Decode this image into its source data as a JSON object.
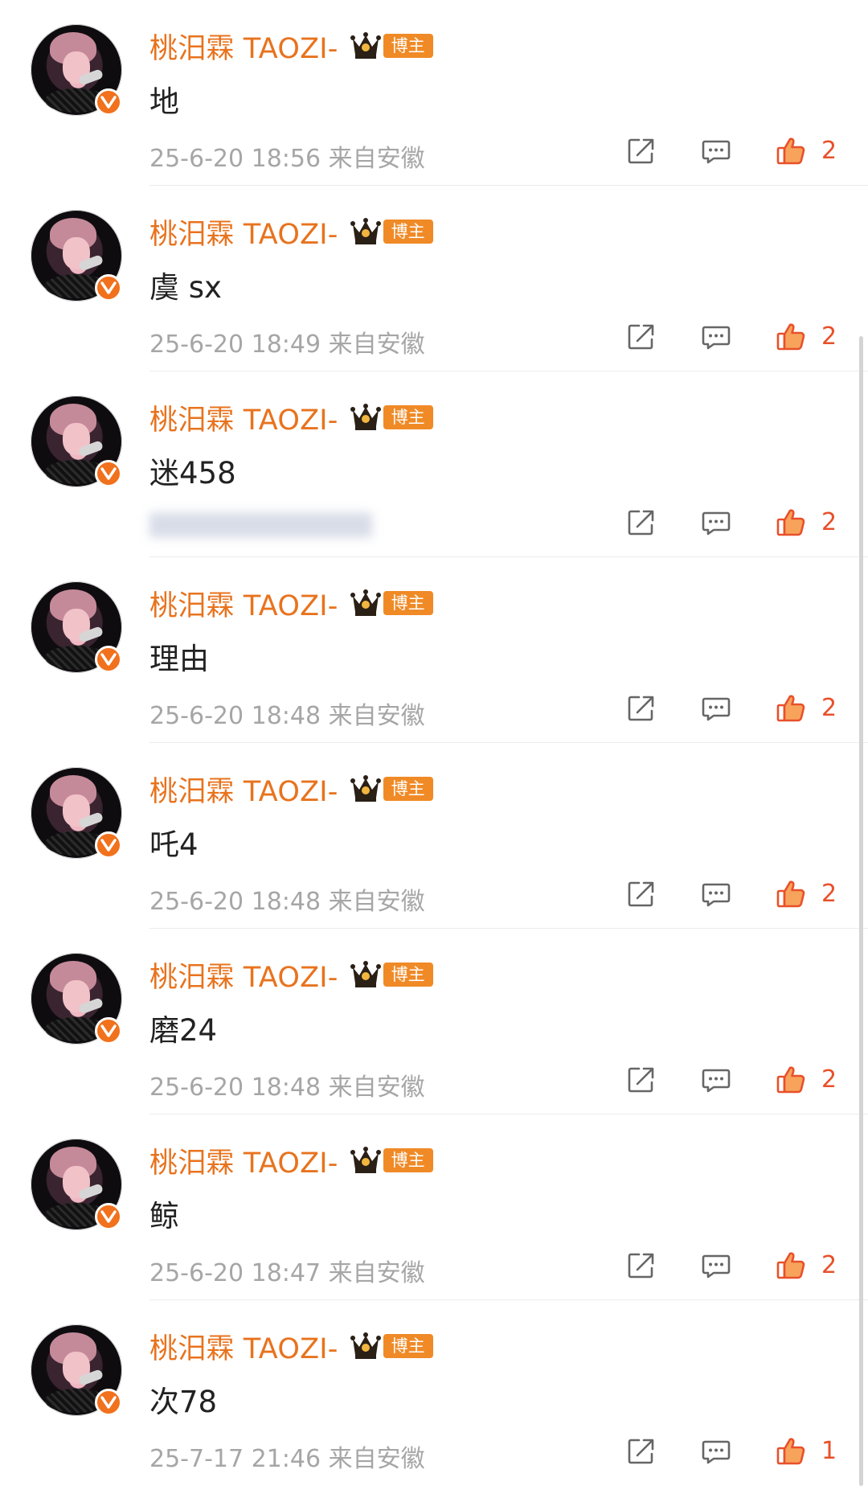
{
  "colors": {
    "name": "#e8731e",
    "badge": "#f08a26",
    "verified": "#f1711d",
    "like": "#e8502a",
    "meta": "#a6a6a6"
  },
  "comments": [
    {
      "author": "桃汨霖 TAOZI-",
      "badge": "博主",
      "text": "地",
      "time": "25-6-20 18:56",
      "location": "来自安徽",
      "likes": "2"
    },
    {
      "author": "桃汨霖 TAOZI-",
      "badge": "博主",
      "text": "虞 sx",
      "time": "25-6-20 18:49",
      "location": "来自安徽",
      "likes": "2"
    },
    {
      "author": "桃汨霖 TAOZI-",
      "badge": "博主",
      "text": "迷458",
      "likes": "2"
    },
    {
      "author": "桃汨霖 TAOZI-",
      "badge": "博主",
      "text": "理由",
      "time": "25-6-20 18:48",
      "location": "来自安徽",
      "likes": "2"
    },
    {
      "author": "桃汨霖 TAOZI-",
      "badge": "博主",
      "text": "吒4",
      "time": "25-6-20 18:48",
      "location": "来自安徽",
      "likes": "2"
    },
    {
      "author": "桃汨霖 TAOZI-",
      "badge": "博主",
      "text": "磨24",
      "time": "25-6-20 18:48",
      "location": "来自安徽",
      "likes": "2"
    },
    {
      "author": "桃汨霖 TAOZI-",
      "badge": "博主",
      "text": "鲸",
      "time": "25-6-20 18:47",
      "location": "来自安徽",
      "likes": "2"
    },
    {
      "author": "桃汨霖 TAOZI-",
      "badge": "博主",
      "text": "次78",
      "time": "25-7-17 21:46",
      "location": "来自安徽",
      "likes": "1"
    }
  ],
  "icons": {
    "share": "share-icon",
    "reply": "comment-icon",
    "like": "thumbs-up-icon",
    "verified": "verified-v-icon",
    "crown": "crown-icon"
  }
}
